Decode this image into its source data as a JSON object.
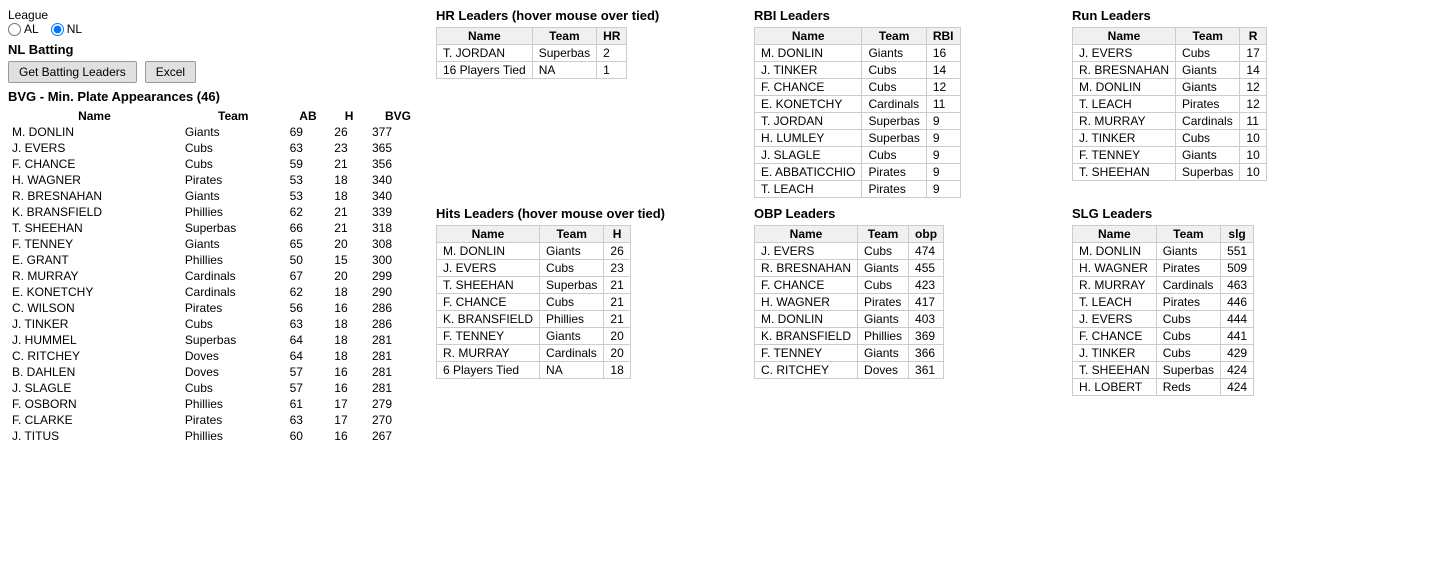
{
  "league": {
    "label": "League",
    "options": [
      "AL",
      "NL"
    ],
    "selected": "NL"
  },
  "batting_section": {
    "title": "NL Batting",
    "get_button": "Get Batting Leaders",
    "excel_button": "Excel"
  },
  "bvg": {
    "title": "BVG - Min. Plate Appearances (46)",
    "columns": [
      "Name",
      "Team",
      "AB",
      "H",
      "BVG"
    ],
    "rows": [
      [
        "M. DONLIN",
        "Giants",
        "69",
        "26",
        "377"
      ],
      [
        "J. EVERS",
        "Cubs",
        "63",
        "23",
        "365"
      ],
      [
        "F. CHANCE",
        "Cubs",
        "59",
        "21",
        "356"
      ],
      [
        "H. WAGNER",
        "Pirates",
        "53",
        "18",
        "340"
      ],
      [
        "R. BRESNAHAN",
        "Giants",
        "53",
        "18",
        "340"
      ],
      [
        "K. BRANSFIELD",
        "Phillies",
        "62",
        "21",
        "339"
      ],
      [
        "T. SHEEHAN",
        "Superbas",
        "66",
        "21",
        "318"
      ],
      [
        "F. TENNEY",
        "Giants",
        "65",
        "20",
        "308"
      ],
      [
        "E. GRANT",
        "Phillies",
        "50",
        "15",
        "300"
      ],
      [
        "R. MURRAY",
        "Cardinals",
        "67",
        "20",
        "299"
      ],
      [
        "E. KONETCHY",
        "Cardinals",
        "62",
        "18",
        "290"
      ],
      [
        "C. WILSON",
        "Pirates",
        "56",
        "16",
        "286"
      ],
      [
        "J. TINKER",
        "Cubs",
        "63",
        "18",
        "286"
      ],
      [
        "J. HUMMEL",
        "Superbas",
        "64",
        "18",
        "281"
      ],
      [
        "C. RITCHEY",
        "Doves",
        "64",
        "18",
        "281"
      ],
      [
        "B. DAHLEN",
        "Doves",
        "57",
        "16",
        "281"
      ],
      [
        "J. SLAGLE",
        "Cubs",
        "57",
        "16",
        "281"
      ],
      [
        "F. OSBORN",
        "Phillies",
        "61",
        "17",
        "279"
      ],
      [
        "F. CLARKE",
        "Pirates",
        "63",
        "17",
        "270"
      ],
      [
        "J. TITUS",
        "Phillies",
        "60",
        "16",
        "267"
      ]
    ]
  },
  "hr_leaders": {
    "title": "HR Leaders (hover mouse over tied)",
    "columns": [
      "Name",
      "Team",
      "HR"
    ],
    "rows": [
      [
        "T. JORDAN",
        "Superbas",
        "2"
      ],
      [
        "16 Players Tied",
        "NA",
        "1"
      ]
    ]
  },
  "rbi_leaders": {
    "title": "RBI Leaders",
    "columns": [
      "Name",
      "Team",
      "RBI"
    ],
    "rows": [
      [
        "M. DONLIN",
        "Giants",
        "16"
      ],
      [
        "J. TINKER",
        "Cubs",
        "14"
      ],
      [
        "F. CHANCE",
        "Cubs",
        "12"
      ],
      [
        "E. KONETCHY",
        "Cardinals",
        "11"
      ],
      [
        "T. JORDAN",
        "Superbas",
        "9"
      ],
      [
        "H. LUMLEY",
        "Superbas",
        "9"
      ],
      [
        "J. SLAGLE",
        "Cubs",
        "9"
      ],
      [
        "E. ABBATICCHIO",
        "Pirates",
        "9"
      ],
      [
        "T. LEACH",
        "Pirates",
        "9"
      ]
    ]
  },
  "run_leaders": {
    "title": "Run Leaders",
    "columns": [
      "Name",
      "Team",
      "R"
    ],
    "rows": [
      [
        "J. EVERS",
        "Cubs",
        "17"
      ],
      [
        "R. BRESNAHAN",
        "Giants",
        "14"
      ],
      [
        "M. DONLIN",
        "Giants",
        "12"
      ],
      [
        "T. LEACH",
        "Pirates",
        "12"
      ],
      [
        "R. MURRAY",
        "Cardinals",
        "11"
      ],
      [
        "J. TINKER",
        "Cubs",
        "10"
      ],
      [
        "F. TENNEY",
        "Giants",
        "10"
      ],
      [
        "T. SHEEHAN",
        "Superbas",
        "10"
      ]
    ]
  },
  "hits_leaders": {
    "title": "Hits Leaders (hover mouse over tied)",
    "columns": [
      "Name",
      "Team",
      "H"
    ],
    "rows": [
      [
        "M. DONLIN",
        "Giants",
        "26"
      ],
      [
        "J. EVERS",
        "Cubs",
        "23"
      ],
      [
        "T. SHEEHAN",
        "Superbas",
        "21"
      ],
      [
        "F. CHANCE",
        "Cubs",
        "21"
      ],
      [
        "K. BRANSFIELD",
        "Phillies",
        "21"
      ],
      [
        "F. TENNEY",
        "Giants",
        "20"
      ],
      [
        "R. MURRAY",
        "Cardinals",
        "20"
      ],
      [
        "6 Players Tied",
        "NA",
        "18"
      ]
    ]
  },
  "obp_leaders": {
    "title": "OBP Leaders",
    "columns": [
      "Name",
      "Team",
      "obp"
    ],
    "rows": [
      [
        "J. EVERS",
        "Cubs",
        "474"
      ],
      [
        "R. BRESNAHAN",
        "Giants",
        "455"
      ],
      [
        "F. CHANCE",
        "Cubs",
        "423"
      ],
      [
        "H. WAGNER",
        "Pirates",
        "417"
      ],
      [
        "M. DONLIN",
        "Giants",
        "403"
      ],
      [
        "K. BRANSFIELD",
        "Phillies",
        "369"
      ],
      [
        "F. TENNEY",
        "Giants",
        "366"
      ],
      [
        "C. RITCHEY",
        "Doves",
        "361"
      ]
    ]
  },
  "slg_leaders": {
    "title": "SLG Leaders",
    "columns": [
      "Name",
      "Team",
      "slg"
    ],
    "rows": [
      [
        "M. DONLIN",
        "Giants",
        "551"
      ],
      [
        "H. WAGNER",
        "Pirates",
        "509"
      ],
      [
        "R. MURRAY",
        "Cardinals",
        "463"
      ],
      [
        "T. LEACH",
        "Pirates",
        "446"
      ],
      [
        "J. EVERS",
        "Cubs",
        "444"
      ],
      [
        "F. CHANCE",
        "Cubs",
        "441"
      ],
      [
        "J. TINKER",
        "Cubs",
        "429"
      ],
      [
        "T. SHEEHAN",
        "Superbas",
        "424"
      ],
      [
        "H. LOBERT",
        "Reds",
        "424"
      ]
    ]
  }
}
